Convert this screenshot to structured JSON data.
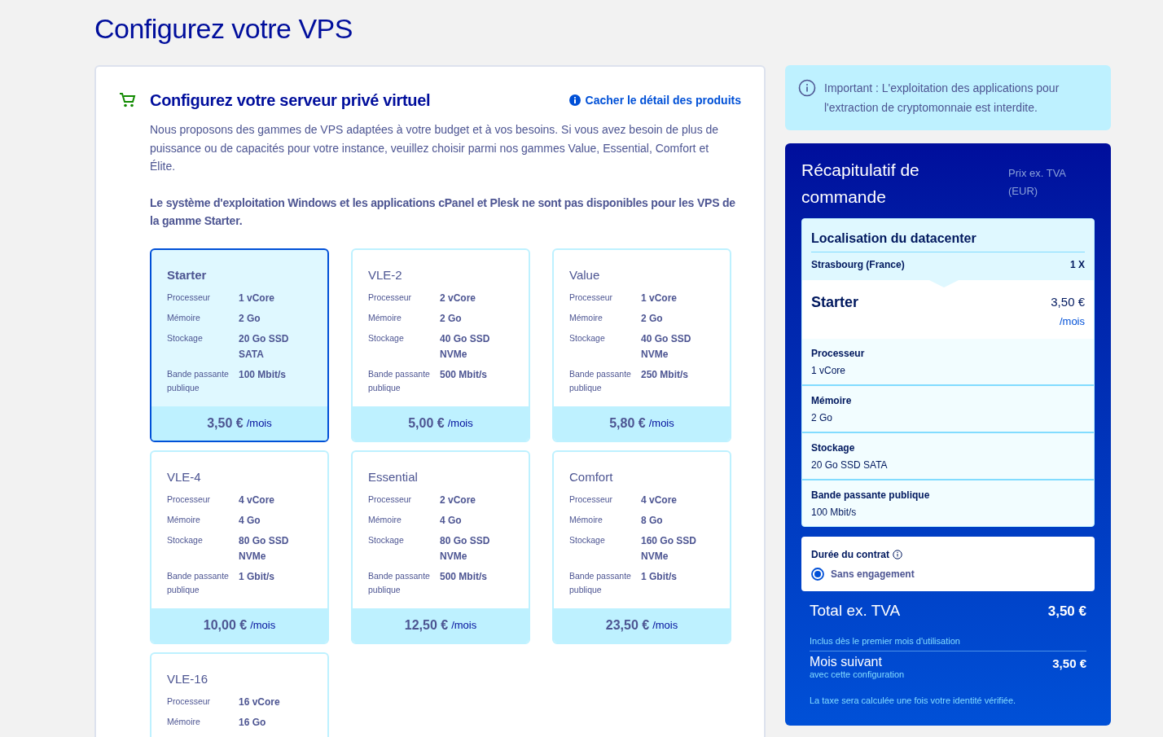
{
  "page_title": "Configurez votre VPS",
  "config_panel": {
    "title": "Configurez votre serveur privé virtuel",
    "toggle_link": "Cacher le détail des produits",
    "description": "Nous proposons des gammes de VPS adaptées à votre budget et à vos besoins. Si vous avez besoin de plus de puissance ou de capacités pour votre instance, veuillez choisir parmi nos gammes Value, Essential, Comfort et Élite.",
    "notice": "Le système d'exploitation Windows et les applications cPanel et Plesk ne sont pas disponibles pour les VPS de la gamme Starter.",
    "plans": [
      {
        "name": "Starter",
        "selected": true,
        "specs": [
          {
            "label": "Processeur",
            "value": "1 vCore"
          },
          {
            "label": "Mémoire",
            "value": "2 Go"
          },
          {
            "label": "Stockage",
            "value": "20 Go SSD SATA"
          },
          {
            "label": "Bande passante publique",
            "value": "100 Mbit/s"
          }
        ],
        "price": "3,50 €",
        "period": "/mois"
      },
      {
        "name": "VLE-2",
        "selected": false,
        "specs": [
          {
            "label": "Processeur",
            "value": "2 vCore"
          },
          {
            "label": "Mémoire",
            "value": "2 Go"
          },
          {
            "label": "Stockage",
            "value": "40 Go SSD NVMe"
          },
          {
            "label": "Bande passante publique",
            "value": "500 Mbit/s"
          }
        ],
        "price": "5,00 €",
        "period": "/mois"
      },
      {
        "name": "Value",
        "selected": false,
        "specs": [
          {
            "label": "Processeur",
            "value": "1 vCore"
          },
          {
            "label": "Mémoire",
            "value": "2 Go"
          },
          {
            "label": "Stockage",
            "value": "40 Go SSD NVMe"
          },
          {
            "label": "Bande passante publique",
            "value": "250 Mbit/s"
          }
        ],
        "price": "5,80 €",
        "period": "/mois"
      },
      {
        "name": "VLE-4",
        "selected": false,
        "specs": [
          {
            "label": "Processeur",
            "value": "4 vCore"
          },
          {
            "label": "Mémoire",
            "value": "4 Go"
          },
          {
            "label": "Stockage",
            "value": "80 Go SSD NVMe"
          },
          {
            "label": "Bande passante publique",
            "value": "1 Gbit/s"
          }
        ],
        "price": "10,00 €",
        "period": "/mois"
      },
      {
        "name": "Essential",
        "selected": false,
        "specs": [
          {
            "label": "Processeur",
            "value": "2 vCore"
          },
          {
            "label": "Mémoire",
            "value": "4 Go"
          },
          {
            "label": "Stockage",
            "value": "80 Go SSD NVMe"
          },
          {
            "label": "Bande passante publique",
            "value": "500 Mbit/s"
          }
        ],
        "price": "12,50 €",
        "period": "/mois"
      },
      {
        "name": "Comfort",
        "selected": false,
        "specs": [
          {
            "label": "Processeur",
            "value": "4 vCore"
          },
          {
            "label": "Mémoire",
            "value": "8 Go"
          },
          {
            "label": "Stockage",
            "value": "160 Go SSD NVMe"
          },
          {
            "label": "Bande passante publique",
            "value": "1 Gbit/s"
          }
        ],
        "price": "23,50 €",
        "period": "/mois"
      },
      {
        "name": "VLE-16",
        "selected": false,
        "specs": [
          {
            "label": "Processeur",
            "value": "16 vCore"
          },
          {
            "label": "Mémoire",
            "value": "16 Go"
          }
        ]
      }
    ]
  },
  "notice": {
    "text": "Important : L'exploitation des applications pour l'extraction de cryptomonnaie est interdite."
  },
  "summary": {
    "title": "Récapitulatif de commande",
    "price_note": "Prix ex. TVA (EUR)",
    "location": {
      "heading": "Localisation du datacenter",
      "city": "Strasbourg (France)",
      "quantity": "1 X"
    },
    "product": {
      "name": "Starter",
      "price": "3,50 €",
      "period": "/mois"
    },
    "specs": [
      {
        "label": "Processeur",
        "value": "1 vCore"
      },
      {
        "label": "Mémoire",
        "value": "2 Go"
      },
      {
        "label": "Stockage",
        "value": "20 Go SSD SATA"
      },
      {
        "label": "Bande passante publique",
        "value": "100 Mbit/s"
      }
    ],
    "contract": {
      "label": "Durée du contrat",
      "options": [
        {
          "label": "Sans engagement",
          "selected": true
        }
      ]
    },
    "total": {
      "label": "Total ex. TVA",
      "amount": "3,50 €",
      "note": "Inclus dès le premier mois d'utilisation"
    },
    "next_month": {
      "label": "Mois suivant",
      "sublabel": "avec cette configuration",
      "amount": "3,50 €"
    },
    "tax_note": "La taxe sera calculée une fois votre identité vérifiée."
  }
}
